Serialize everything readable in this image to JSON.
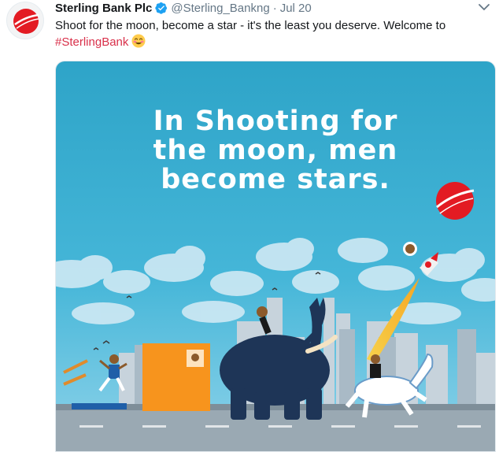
{
  "tweet": {
    "author_name": "Sterling Bank Plc",
    "handle": "@Sterling_Bankng",
    "separator": "·",
    "time": "Jul 20",
    "text_main": "Shoot for the moon, become a star - it's the least you deserve. Welcome to",
    "hashtag": "#SterlingBank"
  },
  "media": {
    "caption": "In Shooting for\nthe moon, men\nbecome stars."
  },
  "colors": {
    "brand_red": "#e31b23",
    "hashtag": "#d9304a",
    "sky_top": "#2ea4c8",
    "verified_blue": "#1da1f2"
  },
  "icons": [
    "sterling-bank-logo-icon",
    "verified-badge-icon",
    "chevron-down-icon",
    "smiling-emoji-icon"
  ]
}
